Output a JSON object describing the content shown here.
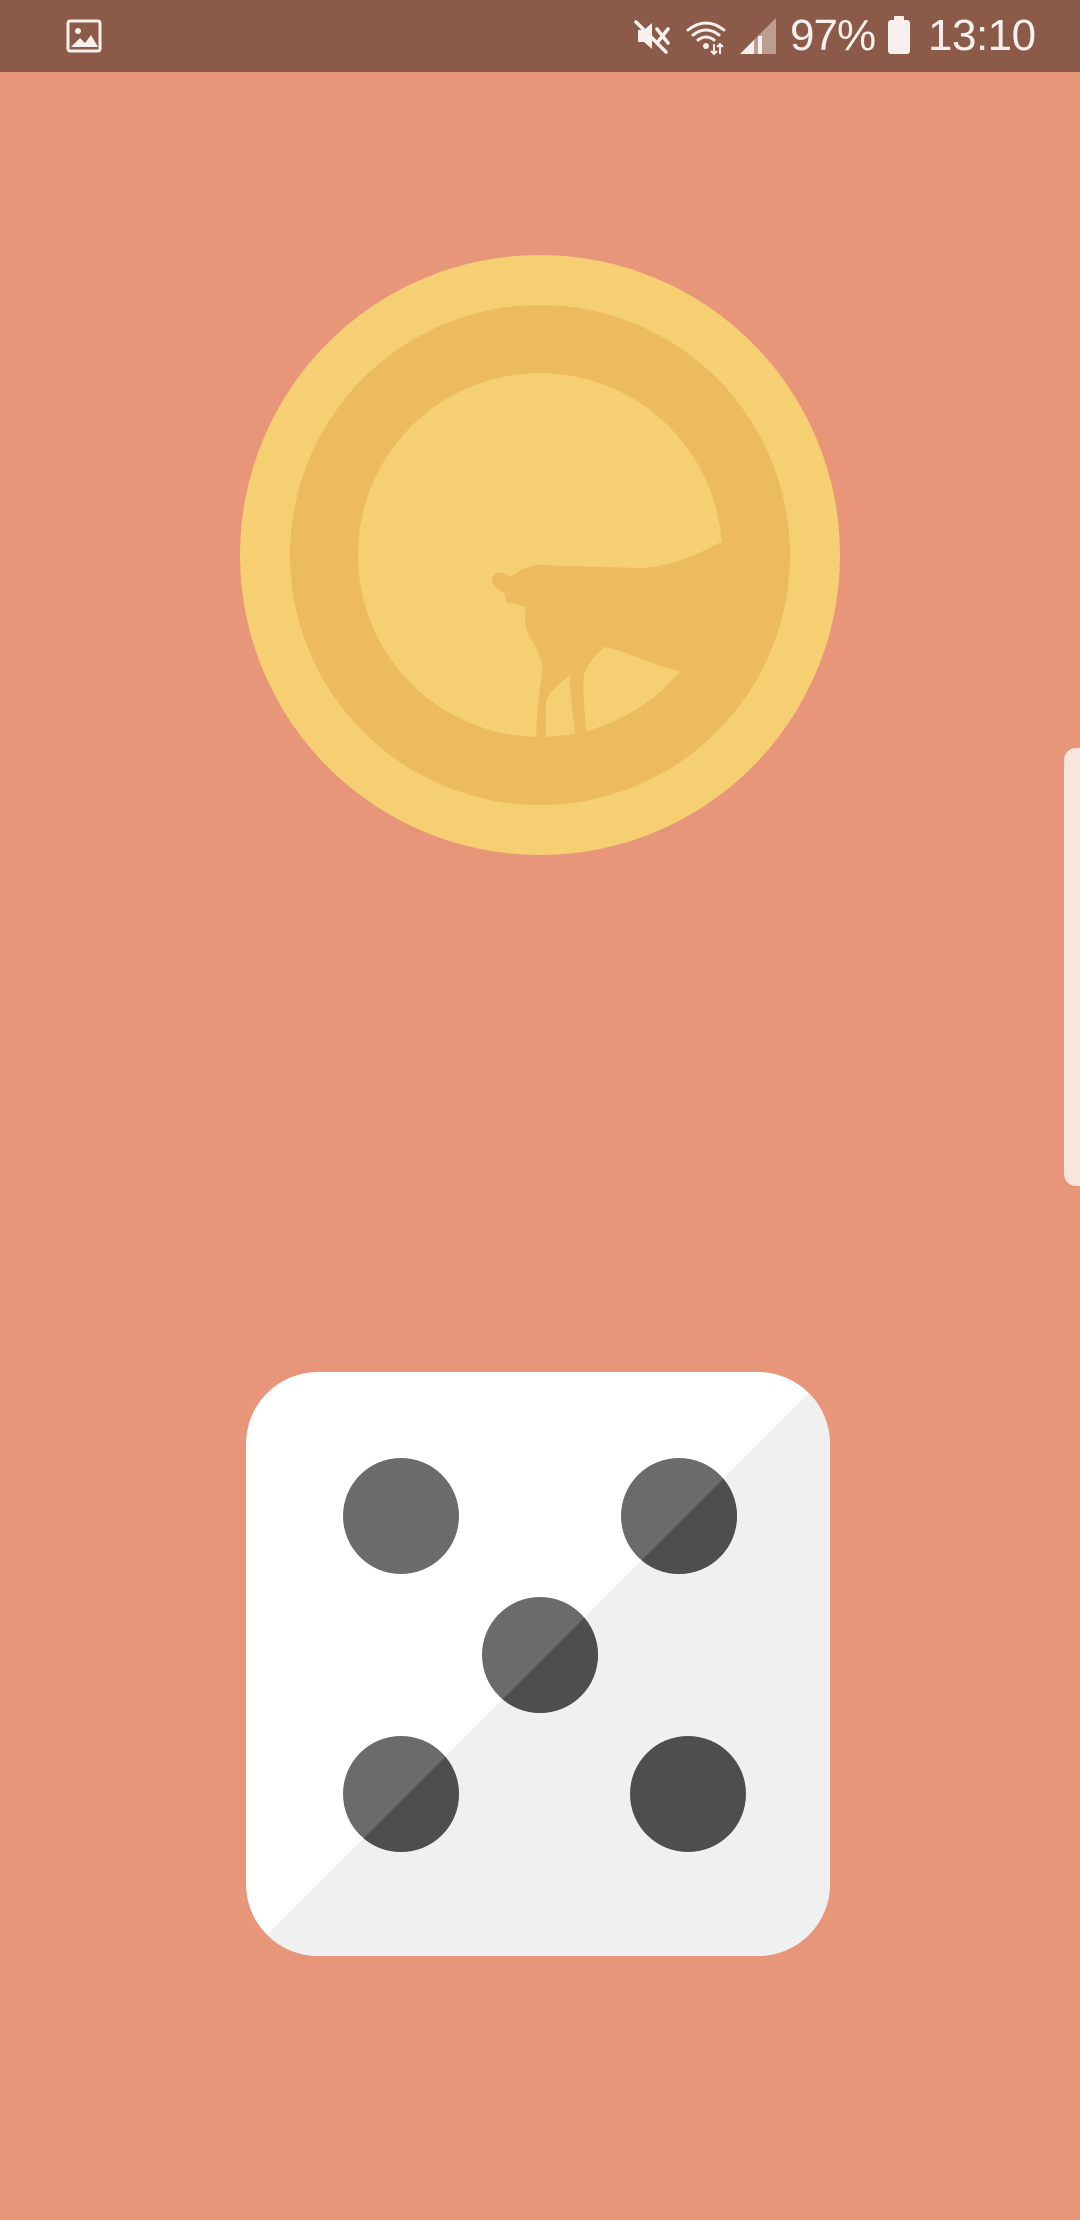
{
  "colors": {
    "background": "#E8967A",
    "status_bar": "#8B5A48",
    "status_text": "#F8F0EC",
    "coin_outer": "#F6CF72",
    "coin_ring": "#EBBB5E",
    "coin_inner": "#F6CF72",
    "coin_silhouette": "#EBBB5E",
    "dice_face_light": "#FFFFFF",
    "dice_face_shadow": "#F0F0F0",
    "dice_pip_light": "#6B6B6B",
    "dice_pip_dark": "#4E4E4E",
    "edge_handle": "#F8E5DC"
  },
  "status_bar": {
    "notification_icon": "image-icon",
    "icons": [
      "mute-icon",
      "wifi-icon",
      "signal-icon",
      "battery-icon"
    ],
    "battery_percent": "97%",
    "time": "13:10"
  },
  "coin": {
    "icon": "deer-coin-icon"
  },
  "dice": {
    "icon": "dice-five-icon",
    "face_value": 5
  },
  "edge_panel": {
    "icon": "edge-panel-handle"
  }
}
